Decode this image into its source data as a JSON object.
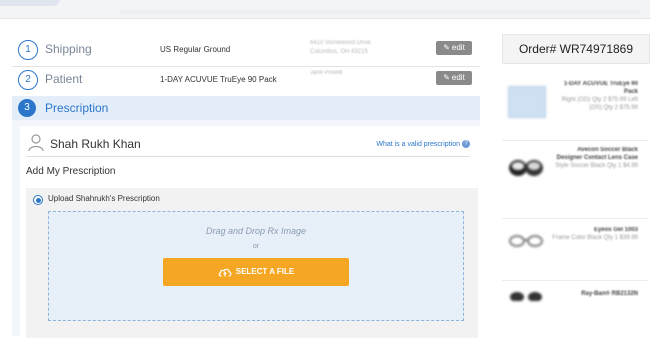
{
  "checkout": {
    "steps": [
      {
        "num": "1",
        "title": "Shipping",
        "summary": "US Regular Ground",
        "extra": "6410 Stonewood Drive Columbus, OH 43215",
        "edit_label": "edit"
      },
      {
        "num": "2",
        "title": "Patient",
        "summary": "1-DAY ACUVUE TruEye 90 Pack",
        "extra": "Jane Powell",
        "edit_label": "edit"
      },
      {
        "num": "3",
        "title": "Prescription"
      }
    ],
    "prescription": {
      "patient_name": "Shah Rukh Khan",
      "valid_link": "What is a valid prescription",
      "add_heading": "Add My Prescription",
      "upload_option": "Upload Shahrukh's Prescription",
      "drag_text": "Drag and Drop Rx Image",
      "or_text": "or",
      "select_button": "SELECT A FILE"
    }
  },
  "sidebar": {
    "order_label": "Order# WR74971869",
    "items": [
      {
        "title": "1-DAY ACUVUE TruEye 90 Pack",
        "detail": "Right (OD) Qty 2 $75.99 Left (OS) Qty 2 $75.99"
      },
      {
        "title": "Avecon Soccer Black Designer Contact Lens Case",
        "detail": "Style Soccer Black Qty 1 $4.99"
      },
      {
        "title": "Eyeos Gel 1003",
        "detail": "Frame Color Black Qty 1 $39.99"
      },
      {
        "title": "Ray-Ban® RB2132N",
        "detail": ""
      }
    ]
  },
  "colors": {
    "accent": "#2b76c9",
    "button": "#f5a623",
    "edit": "#8a8a8a"
  }
}
